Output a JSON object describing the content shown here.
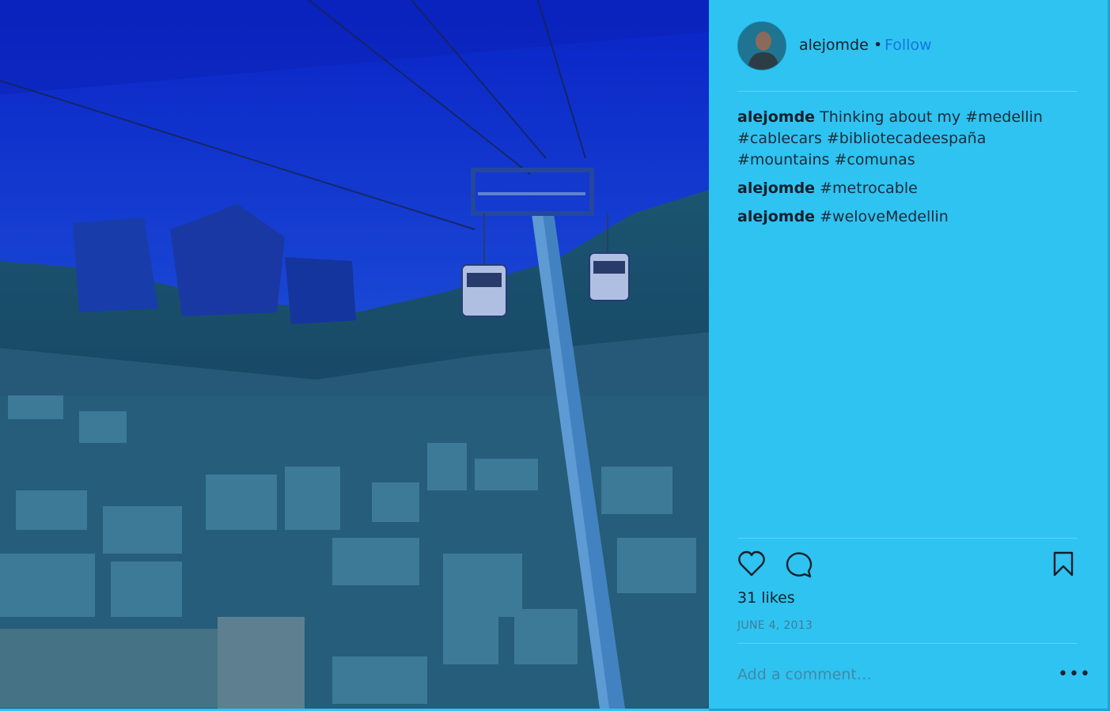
{
  "post": {
    "username": "alejomde",
    "separator": "•",
    "follow_label": "Follow",
    "comments": [
      {
        "user": "alejomde",
        "text": "Thinking about my #medellin #cablecars #bibliotecadeespaña #mountains #comunas"
      },
      {
        "user": "alejomde",
        "text": "#metrocable"
      },
      {
        "user": "alejomde",
        "text": "#weloveMedellin"
      }
    ],
    "likes": "31 likes",
    "date": "JUNE 4, 2013",
    "comment_placeholder": "Add a comment…",
    "more_label": "•••"
  },
  "colors": {
    "panel_bg": "#2fc3f1",
    "follow": "#1276e0"
  },
  "icons": {
    "like": "heart-icon",
    "comment": "speech-bubble-icon",
    "save": "bookmark-icon",
    "more": "more-options-icon"
  }
}
